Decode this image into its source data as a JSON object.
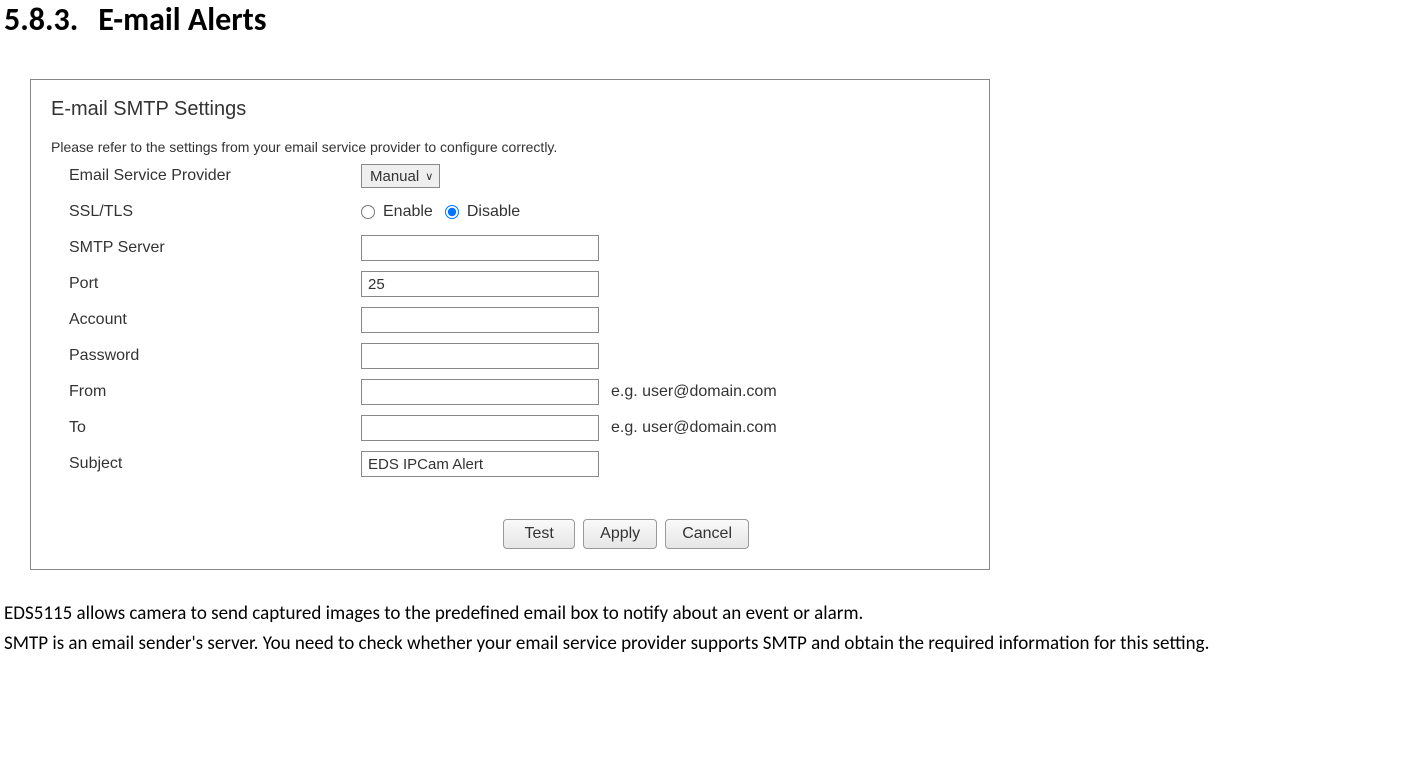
{
  "heading": {
    "number": "5.8.3.",
    "title": "E-mail Alerts"
  },
  "panel": {
    "title": "E-mail SMTP Settings",
    "note": "Please refer to the settings from your email service provider to configure correctly.",
    "rows": {
      "provider": {
        "label": "Email Service Provider",
        "value": "Manual"
      },
      "ssl": {
        "label": "SSL/TLS",
        "enable": "Enable",
        "disable": "Disable"
      },
      "smtp": {
        "label": "SMTP Server",
        "value": ""
      },
      "port": {
        "label": "Port",
        "value": "25"
      },
      "account": {
        "label": "Account",
        "value": ""
      },
      "password": {
        "label": "Password",
        "value": ""
      },
      "from": {
        "label": "From",
        "value": "",
        "hint": "e.g. user@domain.com"
      },
      "to": {
        "label": "To",
        "value": "",
        "hint": "e.g. user@domain.com"
      },
      "subject": {
        "label": "Subject",
        "value": "EDS IPCam Alert"
      }
    },
    "buttons": {
      "test": "Test",
      "apply": "Apply",
      "cancel": "Cancel"
    }
  },
  "description": {
    "p1": "EDS5115 allows camera to send captured images to the predefined email box to notify about an event or alarm.",
    "p2": "SMTP is an email sender's server. You need to check whether your email service provider supports SMTP and obtain the required information for this setting."
  }
}
